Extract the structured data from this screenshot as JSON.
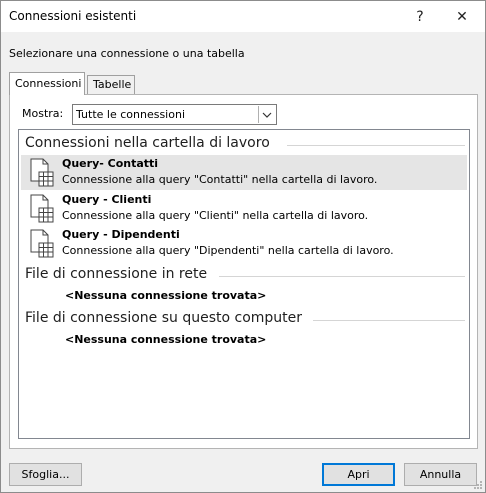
{
  "window": {
    "title": "Connessioni esistenti",
    "help_glyph": "?",
    "close_glyph": "✕"
  },
  "prompt": "Selezionare una connessione o una tabella",
  "tabs": [
    {
      "label": "Connessioni",
      "active": true
    },
    {
      "label": "Tabelle",
      "active": false
    }
  ],
  "filter": {
    "label": "Mostra:",
    "selected": "Tutte le connessioni"
  },
  "groups": {
    "workbook": {
      "title": "Connessioni nella cartella di lavoro",
      "items": [
        {
          "name": "Query- Contatti",
          "description": "Connessione alla query \"Contatti\" nella cartella di lavoro.",
          "selected": true
        },
        {
          "name": "Query - Clienti",
          "description": "Connessione alla query \"Clienti\" nella cartella di lavoro.",
          "selected": false
        },
        {
          "name": "Query - Dipendenti",
          "description": "Connessione alla query \"Dipendenti\" nella cartella di lavoro.",
          "selected": false
        }
      ]
    },
    "network": {
      "title": "File di connessione in rete",
      "empty_text": "<Nessuna connessione trovata>"
    },
    "computer": {
      "title": "File di connessione su questo computer",
      "empty_text": "<Nessuna connessione trovata>"
    }
  },
  "buttons": {
    "browse": "Sfoglia...",
    "open": "Apri",
    "cancel": "Annulla"
  },
  "icons": {
    "item_icon": "table-document-icon",
    "dropdown_icon": "chevron-down-icon",
    "accent": "#0078d7"
  }
}
